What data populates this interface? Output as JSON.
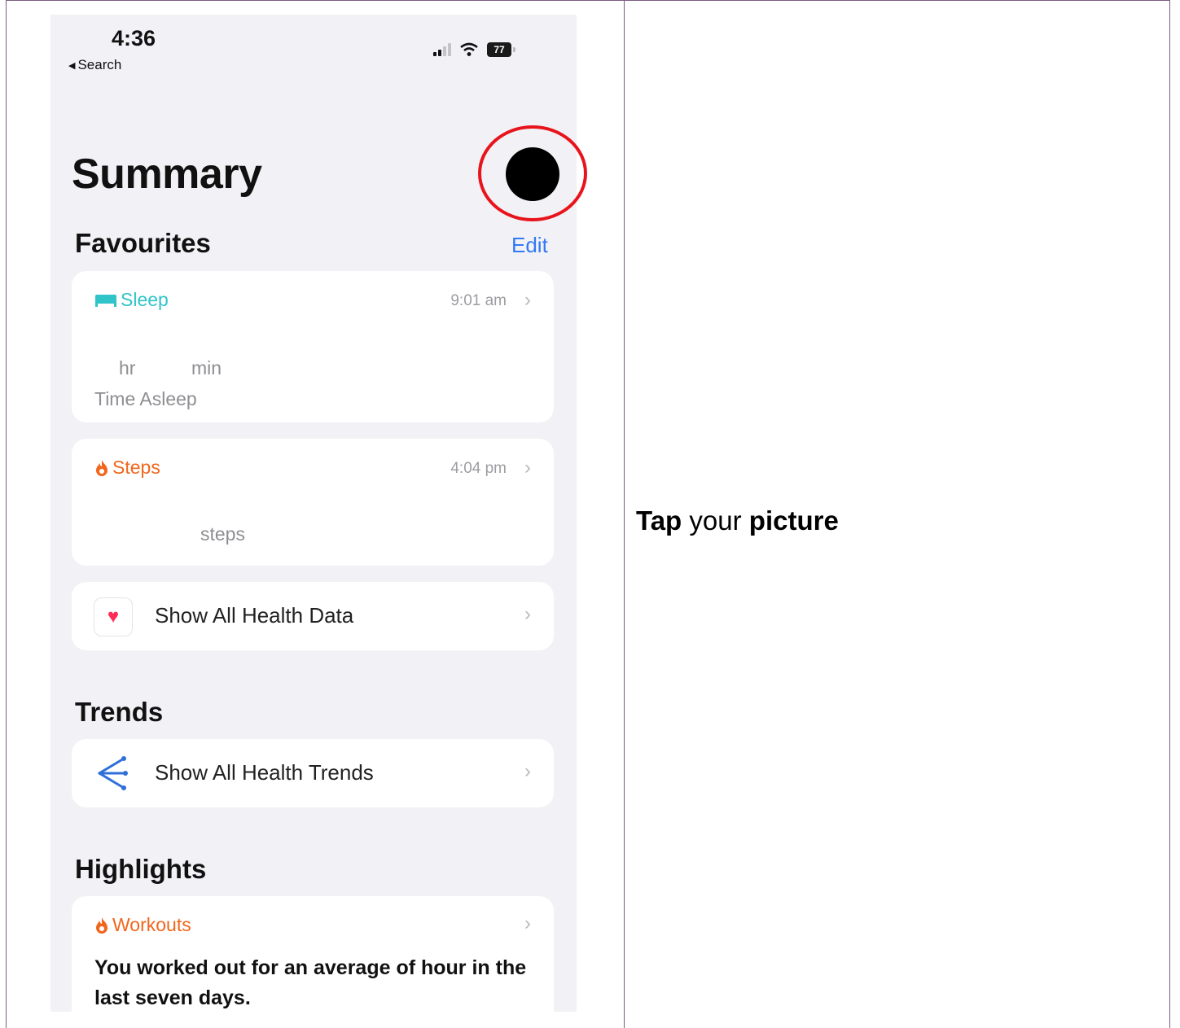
{
  "status_bar": {
    "time": "4:36",
    "back_label": "Search",
    "battery": "77"
  },
  "page": {
    "title": "Summary"
  },
  "favourites": {
    "title": "Favourites",
    "edit": "Edit",
    "sleep": {
      "label": "Sleep",
      "time": "9:01 am",
      "hr_unit": "hr",
      "min_unit": "min",
      "caption": "Time Asleep",
      "icon": "bed-icon",
      "color": "#30c4c9"
    },
    "steps": {
      "label": "Steps",
      "time": "4:04 pm",
      "unit": "steps",
      "icon": "flame-icon",
      "color": "#f2661c"
    },
    "show_all": {
      "label": "Show All Health Data",
      "icon": "heart-icon"
    }
  },
  "trends": {
    "title": "Trends",
    "show_all": {
      "label": "Show All Health Trends",
      "icon": "trends-icon"
    }
  },
  "highlights": {
    "title": "Highlights",
    "workouts": {
      "label": "Workouts",
      "text": "You worked out for an average of   hour in the last seven days.",
      "icon": "flame-icon"
    }
  },
  "instruction": {
    "verb": "Tap",
    "middle": "your",
    "object": "picture"
  },
  "colors": {
    "accent": "#3478f6",
    "highlight_ring": "#e8141c"
  }
}
